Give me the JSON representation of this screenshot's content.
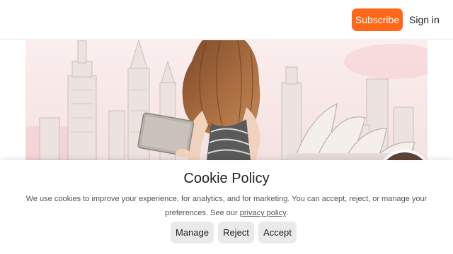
{
  "header": {
    "subscribe_label": "Subscribe",
    "signin_label": "Sign in"
  },
  "hero": {
    "image": "illustration-woman-laptop-skylines"
  },
  "cookie": {
    "title": "Cookie Policy",
    "text_before_link": "We use cookies to improve your experience, for analytics, and for marketing. You can accept, reject, or manage your preferences. See our ",
    "link_text": "privacy policy",
    "text_after_link": ".",
    "buttons": {
      "manage": "Manage",
      "reject": "Reject",
      "accept": "Accept"
    }
  },
  "colors": {
    "accent": "#ff6719",
    "button_bg": "#eaeaea",
    "header_border": "#e6e6e6"
  }
}
